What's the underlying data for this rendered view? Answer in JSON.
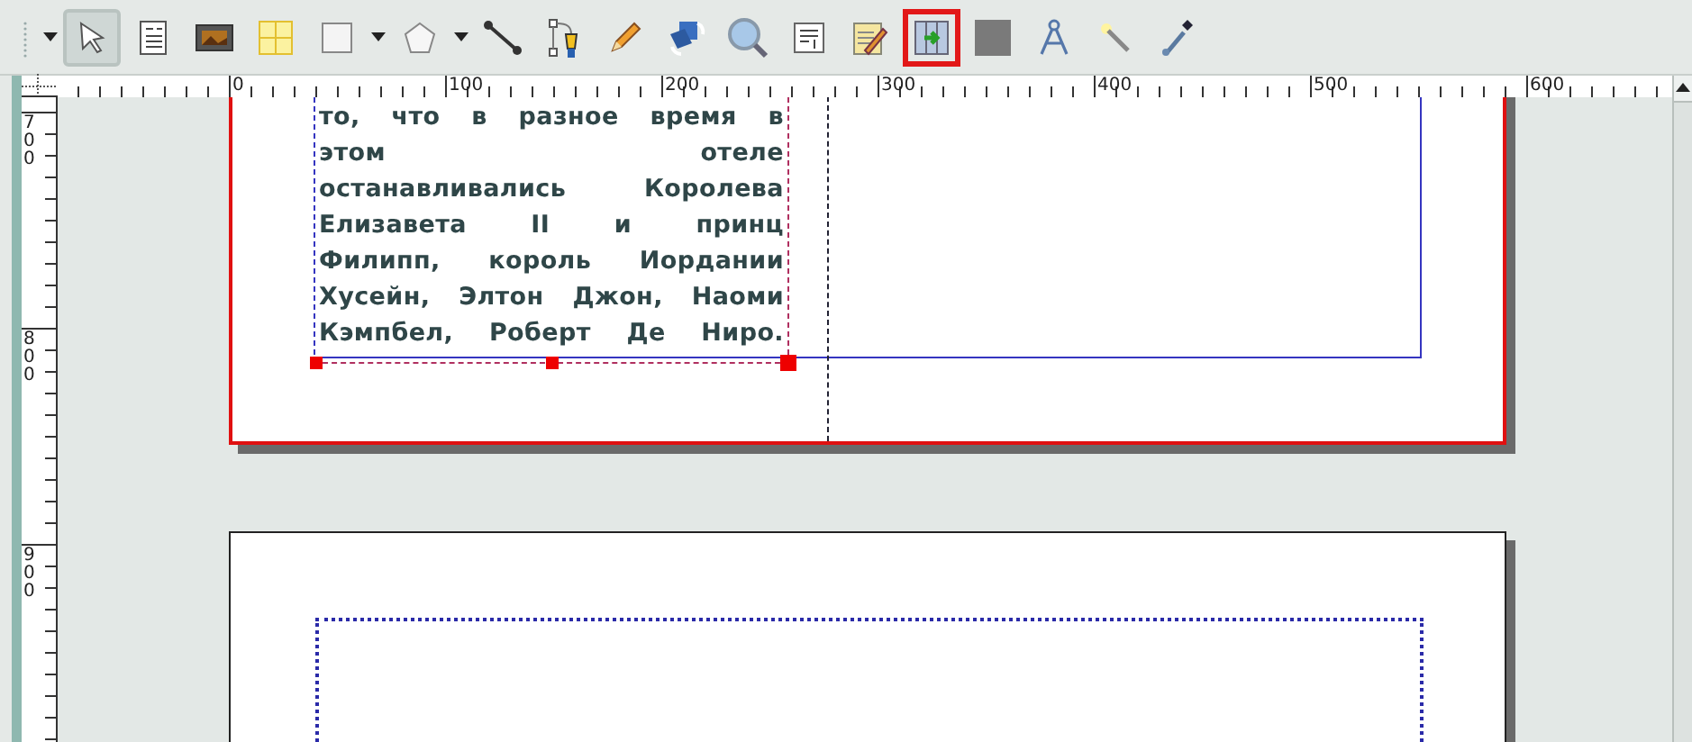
{
  "toolbar": {
    "tools": [
      {
        "kind": "dropdown",
        "selected": false,
        "highlighted": false
      },
      {
        "kind": "select",
        "selected": true,
        "highlighted": false
      },
      {
        "kind": "text-frame",
        "selected": false,
        "highlighted": false
      },
      {
        "kind": "image-frame",
        "selected": false,
        "highlighted": false
      },
      {
        "kind": "table",
        "selected": false,
        "highlighted": false
      },
      {
        "kind": "shape",
        "selected": false,
        "highlighted": false
      },
      {
        "kind": "dropdown",
        "selected": false,
        "highlighted": false
      },
      {
        "kind": "polygon",
        "selected": false,
        "highlighted": false
      },
      {
        "kind": "dropdown",
        "selected": false,
        "highlighted": false
      },
      {
        "kind": "line",
        "selected": false,
        "highlighted": false
      },
      {
        "kind": "bezier",
        "selected": false,
        "highlighted": false
      },
      {
        "kind": "pencil",
        "selected": false,
        "highlighted": false
      },
      {
        "kind": "rotate",
        "selected": false,
        "highlighted": false
      },
      {
        "kind": "zoom",
        "selected": false,
        "highlighted": false
      },
      {
        "kind": "edit-text",
        "selected": false,
        "highlighted": false
      },
      {
        "kind": "story-editor",
        "selected": false,
        "highlighted": false
      },
      {
        "kind": "link-frames",
        "selected": false,
        "highlighted": true
      },
      {
        "kind": "unlink-frames",
        "selected": false,
        "highlighted": false
      },
      {
        "kind": "measure",
        "selected": false,
        "highlighted": false
      },
      {
        "kind": "wand",
        "selected": false,
        "highlighted": false
      },
      {
        "kind": "eyedropper",
        "selected": false,
        "highlighted": false
      }
    ]
  },
  "ruler": {
    "horizontal_labels": [
      "0",
      "100",
      "200",
      "300",
      "400",
      "500",
      "600"
    ],
    "vertical_labels": [
      "700",
      "800",
      "900"
    ]
  },
  "text_frame": {
    "lines": [
      "то, что в разное время в",
      "этом отеле",
      "останавливались Королева",
      "Елизавета II и принц",
      "Филипп, король Иордании",
      "Хусейн, Элтон Джон, Наоми",
      "Кэмпбел, Роберт Де Ниро."
    ]
  }
}
